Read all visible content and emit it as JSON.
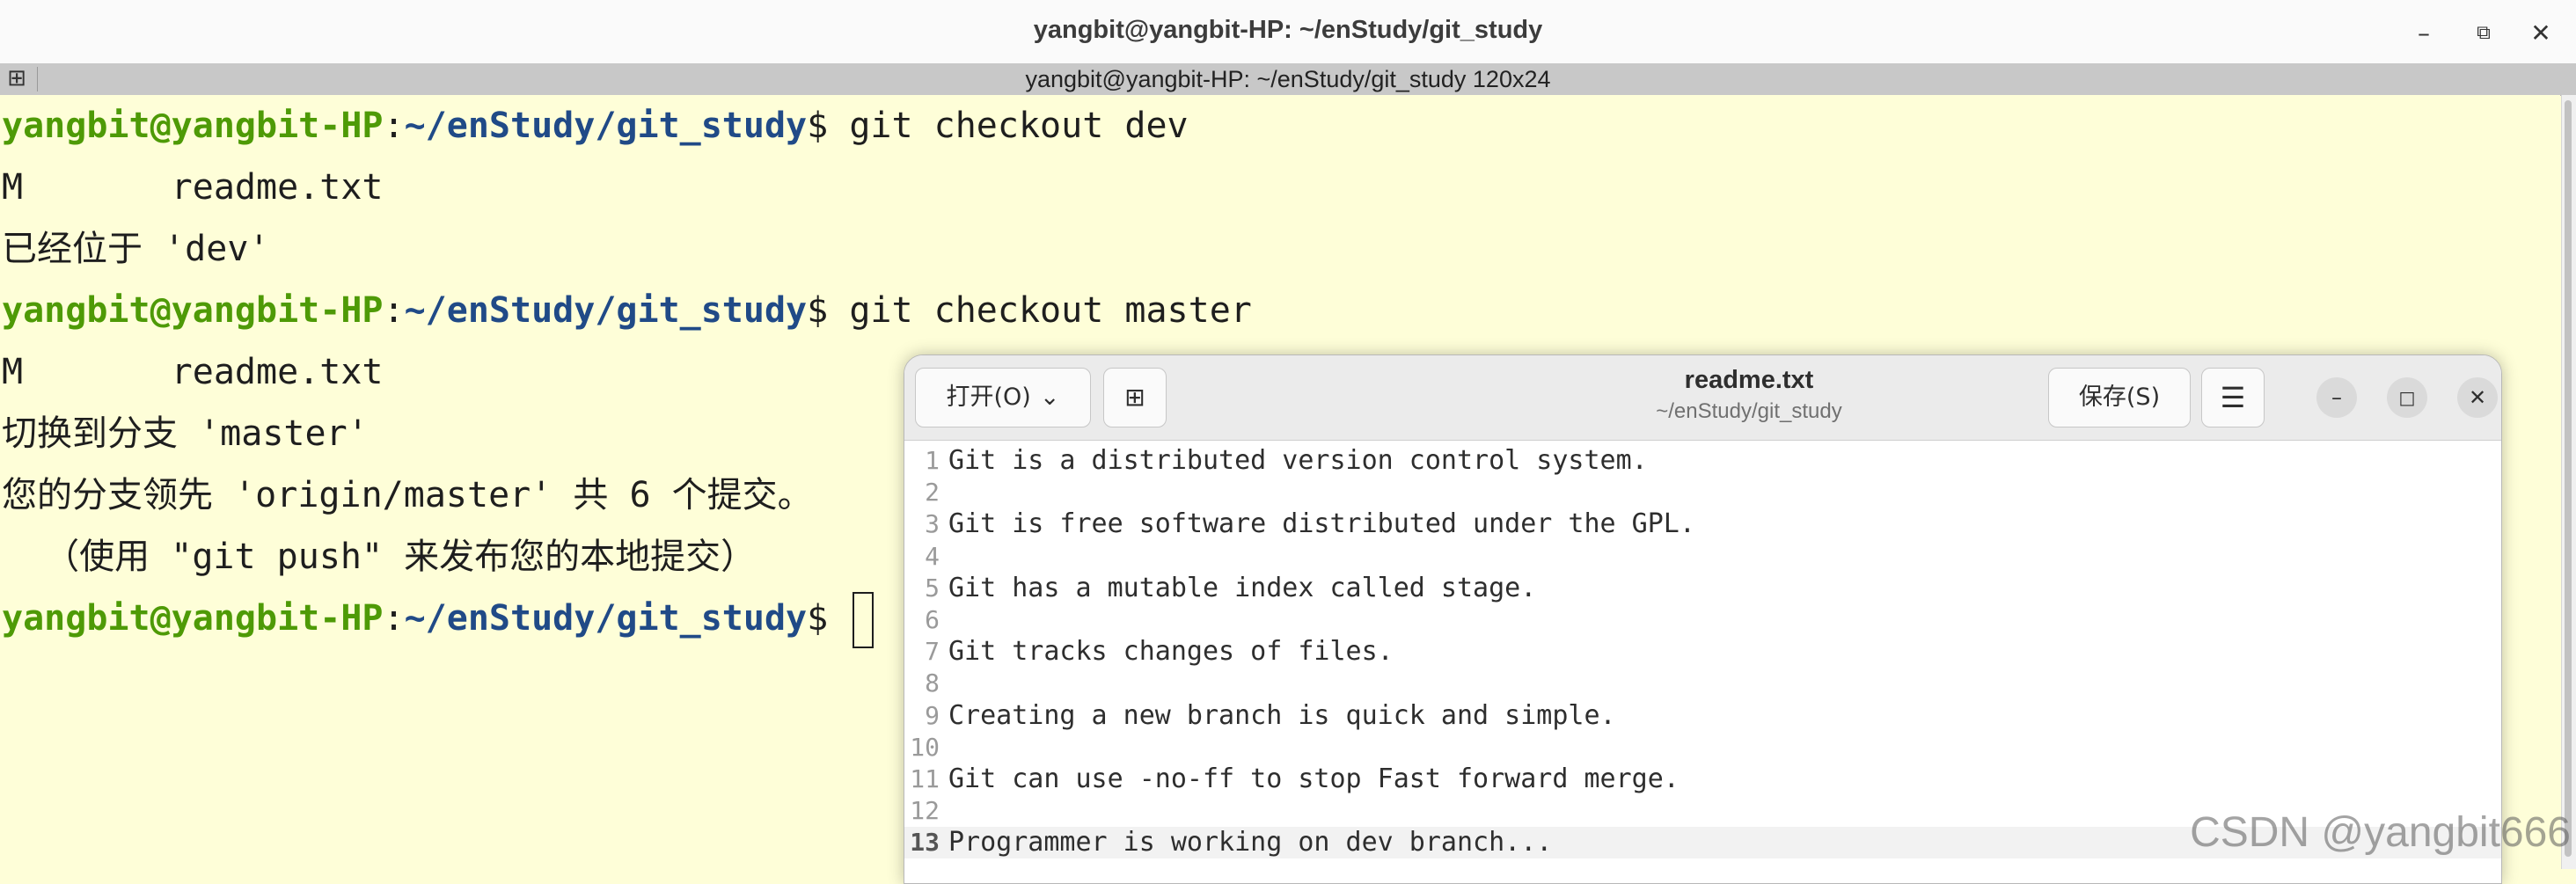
{
  "terminal": {
    "window_title": "yangbit@yangbit-HP: ~/enStudy/git_study",
    "tab_title": "yangbit@yangbit-HP: ~/enStudy/git_study 120x24",
    "prompt": {
      "user": "yangbit@yangbit-HP",
      "colon": ":",
      "path": "~/enStudy/git_study",
      "symbol": "$ "
    },
    "lines": [
      {
        "type": "prompt",
        "command": "git checkout dev"
      },
      {
        "type": "output",
        "text": "M       readme.txt"
      },
      {
        "type": "output",
        "text": "已经位于 'dev'"
      },
      {
        "type": "prompt",
        "command": "git checkout master"
      },
      {
        "type": "output",
        "text": "M       readme.txt"
      },
      {
        "type": "output",
        "text": "切换到分支 'master'"
      },
      {
        "type": "output",
        "text": "您的分支领先 'origin/master' 共 6 个提交。"
      },
      {
        "type": "output",
        "text": "  （使用 \"git push\" 来发布您的本地提交）"
      },
      {
        "type": "prompt",
        "command": ""
      }
    ]
  },
  "gedit": {
    "title": "readme.txt",
    "subtitle": "~/enStudy/git_study",
    "open_label": "打开(O)",
    "save_label": "保存(S)",
    "current_line": 13,
    "lines": [
      {
        "num": "1",
        "text": "Git is a distributed version control system."
      },
      {
        "num": "2",
        "text": ""
      },
      {
        "num": "3",
        "text": "Git is free software distributed under the GPL."
      },
      {
        "num": "4",
        "text": ""
      },
      {
        "num": "5",
        "text": "Git has a mutable index called stage."
      },
      {
        "num": "6",
        "text": ""
      },
      {
        "num": "7",
        "text": "Git tracks changes of files."
      },
      {
        "num": "8",
        "text": ""
      },
      {
        "num": "9",
        "text": "Creating a new branch is quick and simple."
      },
      {
        "num": "10",
        "text": ""
      },
      {
        "num": "11",
        "text": "Git can use -no-ff to stop Fast forward merge."
      },
      {
        "num": "12",
        "text": ""
      },
      {
        "num": "13",
        "text": "Programmer is working on dev branch..."
      }
    ]
  },
  "watermark": "CSDN @yangbit666"
}
